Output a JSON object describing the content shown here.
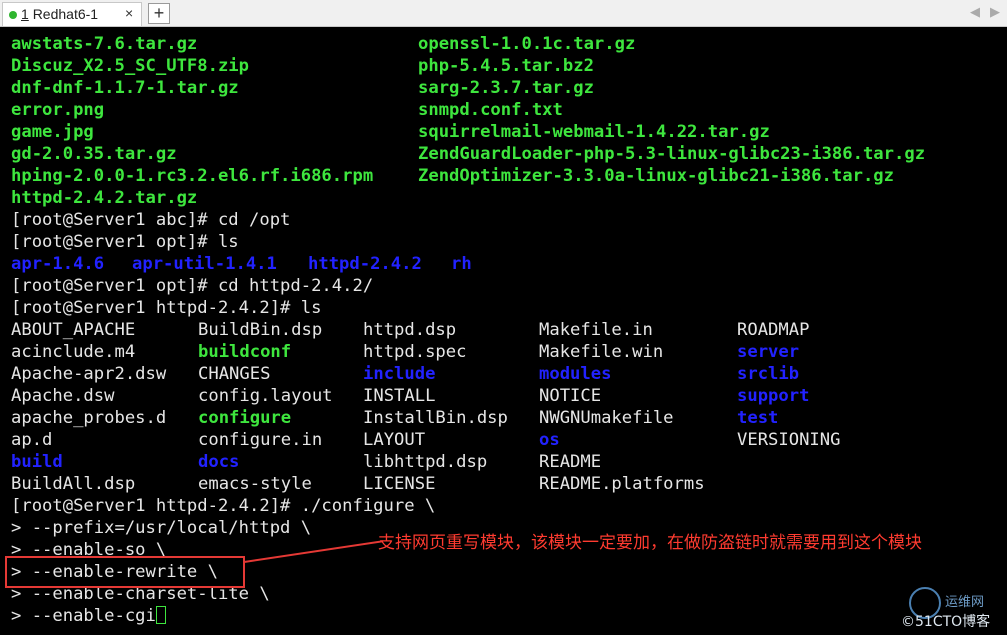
{
  "window": {
    "tab": {
      "number": "1",
      "title": "Redhat6-1",
      "close": "×",
      "status_color": "#2fb52f"
    },
    "new_tab": "+",
    "nav_left": "◀",
    "nav_right": "▶"
  },
  "colors": {
    "executable": "#3ee63e",
    "directory": "#2222ff",
    "text": "#e0e0e0",
    "annotation": "#ff3b30"
  },
  "terminal": {
    "listing1_left": [
      "awstats-7.6.tar.gz",
      "Discuz_X2.5_SC_UTF8.zip",
      "dnf-dnf-1.1.7-1.tar.gz",
      "error.png",
      "game.jpg",
      "gd-2.0.35.tar.gz",
      "hping-2.0.0-1.rc3.2.el6.rf.i686.rpm",
      "httpd-2.4.2.tar.gz"
    ],
    "listing1_right": [
      "openssl-1.0.1c.tar.gz",
      "php-5.4.5.tar.bz2",
      "sarg-2.3.7.tar.gz",
      "snmpd.conf.txt",
      "squirrelmail-webmail-1.4.22.tar.gz",
      "ZendGuardLoader-php-5.3-linux-glibc23-i386.tar.gz",
      "ZendOptimizer-3.3.0a-linux-glibc21-i386.tar.gz"
    ],
    "cmd1": "[root@Server1 abc]# cd /opt",
    "cmd2": "[root@Server1 opt]# ls",
    "opt_listing": [
      "apr-1.4.6",
      "apr-util-1.4.1",
      "httpd-2.4.2",
      "rh"
    ],
    "cmd3": "[root@Server1 opt]# cd httpd-2.4.2/",
    "cmd4": "[root@Server1 httpd-2.4.2]# ls",
    "httpd_listing": {
      "col1": [
        "ABOUT_APACHE",
        "acinclude.m4",
        "Apache-apr2.dsw",
        "Apache.dsw",
        "apache_probes.d",
        "ap.d",
        "build",
        "BuildAll.dsp"
      ],
      "col2": [
        "BuildBin.dsp",
        "buildconf",
        "CHANGES",
        "config.layout",
        "configure",
        "configure.in",
        "docs",
        "emacs-style"
      ],
      "col3": [
        "httpd.dsp",
        "httpd.spec",
        "include",
        "INSTALL",
        "InstallBin.dsp",
        "LAYOUT",
        "libhttpd.dsp",
        "LICENSE"
      ],
      "col4": [
        "Makefile.in",
        "Makefile.win",
        "modules",
        "NOTICE",
        "NWGNUmakefile",
        "os",
        "README",
        "README.platforms"
      ],
      "col5": [
        "ROADMAP",
        "server",
        "srclib",
        "support",
        "test",
        "VERSIONING"
      ]
    },
    "cmd5": "[root@Server1 httpd-2.4.2]# ./configure \\",
    "cont1": "> --prefix=/usr/local/httpd \\",
    "cont2": "> --enable-so \\",
    "cont3": "> --enable-rewrite \\",
    "cont4": "> --enable-charset-lite \\",
    "cont5": "> --enable-cgi"
  },
  "annotation": "支持网页重写模块，该模块一定要加，在做防盗链时就需要用到这个模块",
  "watermark": {
    "top": "运维网",
    "bottom": "©51CTO博客"
  }
}
